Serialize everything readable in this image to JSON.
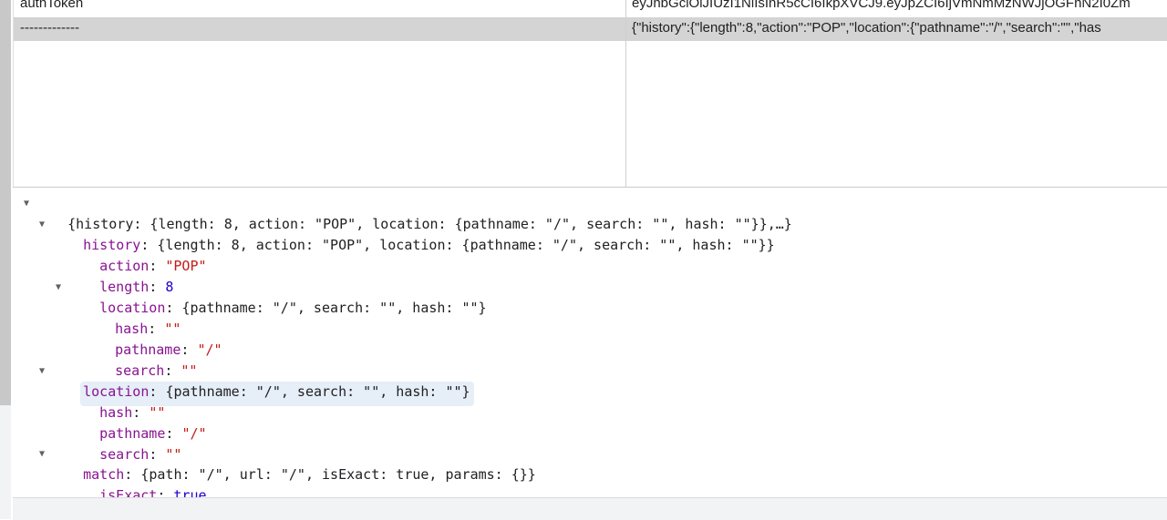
{
  "table": {
    "rows": [
      {
        "key": "authToken",
        "value": "eyJhbGciOiJIUzI1NiIsInR5cCI6IkpXVCJ9.eyJpZCI6IjVmNmMzNWJjOGFhN2I0Zm"
      },
      {
        "key": "-------------",
        "value": "{\"history\":{\"length\":8,\"action\":\"POP\",\"location\":{\"pathname\":\"/\",\"search\":\"\",\"has"
      }
    ]
  },
  "tree": {
    "root_summary": "{history: {length: 8, action: \"POP\", location: {pathname: \"/\", search: \"\", hash: \"\"}},…}",
    "history": {
      "key": "history",
      "summary": "{length: 8, action: \"POP\", location: {pathname: \"/\", search: \"\", hash: \"\"}}",
      "action_key": "action",
      "action_value": "\"POP\"",
      "length_key": "length",
      "length_value": "8",
      "location_key": "location",
      "location_summary": "{pathname: \"/\", search: \"\", hash: \"\"}",
      "hash_key": "hash",
      "hash_value": "\"\"",
      "pathname_key": "pathname",
      "pathname_value": "\"/\"",
      "search_key": "search",
      "search_value": "\"\""
    },
    "location": {
      "key": "location",
      "summary": "{pathname: \"/\", search: \"\", hash: \"\"}",
      "hash_key": "hash",
      "hash_value": "\"\"",
      "pathname_key": "pathname",
      "pathname_value": "\"/\"",
      "search_key": "search",
      "search_value": "\"\""
    },
    "match": {
      "key": "match",
      "summary": "{path: \"/\", url: \"/\", isExact: true, params: {}}",
      "isExact_key": "isExact",
      "isExact_value": "true",
      "params_key": "params",
      "params_value": "{}"
    }
  },
  "colors": {
    "key": "#881391",
    "string": "#c41a16",
    "number": "#1c00cf",
    "selected_row": "#d4d4d4",
    "highlight": "#e6eef7"
  }
}
